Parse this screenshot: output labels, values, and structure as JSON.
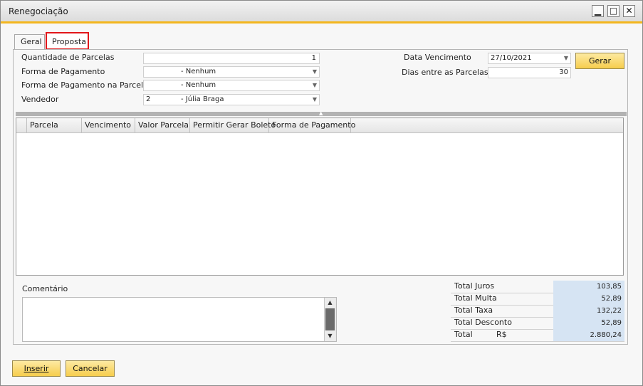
{
  "window": {
    "title": "Renegociação",
    "controls": {
      "minimize": "▁",
      "maximize": "□",
      "close": "✕"
    }
  },
  "tabs": [
    {
      "label": "Geral",
      "selected": false
    },
    {
      "label": "Proposta",
      "selected": true
    }
  ],
  "form": {
    "quantidade_label": "Quantidade de Parcelas",
    "quantidade_value": "1",
    "forma_pagamento_label": "Forma de Pagamento",
    "forma_pagamento_value": "- Nenhum",
    "forma_pagamento_parcela_label": "Forma de Pagamento na Parcela",
    "forma_pagamento_parcela_value": "- Nenhum",
    "vendedor_label": "Vendedor",
    "vendedor_code": "2",
    "vendedor_name": "- Júlia Braga",
    "data_vencimento_label": "Data Vencimento",
    "data_vencimento_value": "27/10/2021",
    "dias_label": "Dias entre as Parcelas",
    "dias_value": "30",
    "gerar_label": "Gerar"
  },
  "grid": {
    "columns": [
      "Parcela",
      "Vencimento",
      "Valor Parcela",
      "Permitir Gerar Boleto",
      "Forma de Pagamento"
    ]
  },
  "comment": {
    "label": "Comentário"
  },
  "totals": [
    {
      "label": "Total  Juros",
      "value": "103,85"
    },
    {
      "label": "Total Multa",
      "value": "52,89"
    },
    {
      "label": "Total Taxa",
      "value": "132,22"
    },
    {
      "label": "Total Desconto",
      "value": "52,89"
    },
    {
      "label": "Total",
      "currency": "R$",
      "value": "2.880,24"
    }
  ],
  "footer": {
    "inserir_label": "Inserir",
    "cancelar_label": "Cancelar"
  },
  "colors": {
    "accent": "#f3b61f",
    "tab_highlight": "#e2161a",
    "total_value_bg": "#d6e4f3"
  }
}
